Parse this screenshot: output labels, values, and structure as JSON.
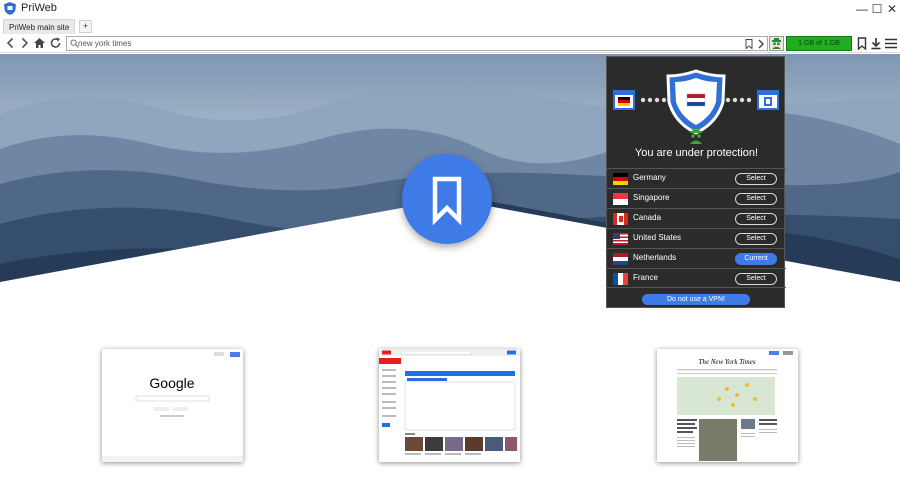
{
  "window": {
    "title": "PriWeb",
    "minimize_label": "—",
    "maximize_label": "☐",
    "close_label": "✕"
  },
  "tabs": [
    {
      "label": "PriWeb main site"
    }
  ],
  "new_tab_label": "+",
  "address_bar": {
    "value": "new york times"
  },
  "traffic": {
    "label": "1 GB of 1 GB",
    "used_fraction": 1.0,
    "color": "#1fae1f"
  },
  "icons": {
    "back": "chevron-left-icon",
    "forward": "chevron-right-icon",
    "home": "home-icon",
    "reload": "reload-icon",
    "search": "search-icon",
    "bookmark": "bookmark-icon",
    "download": "download-icon",
    "menu": "hamburger-icon",
    "vpn": "vpn-agent-icon"
  },
  "vpn_panel": {
    "status_text": "You are under protection!",
    "source_flag": "Germany",
    "active_flag": "Netherlands",
    "countries": [
      {
        "name": "Germany",
        "action": "Select",
        "current": false
      },
      {
        "name": "Singapore",
        "action": "Select",
        "current": false
      },
      {
        "name": "Canada",
        "action": "Select",
        "current": false
      },
      {
        "name": "United States",
        "action": "Select",
        "current": false
      },
      {
        "name": "Netherlands",
        "action": "Current",
        "current": true
      },
      {
        "name": "France",
        "action": "Select",
        "current": false
      }
    ],
    "no_vpn_label": "Do not use a VPN!"
  },
  "speed_dial": [
    {
      "site": "google",
      "logo": "Google"
    },
    {
      "site": "youtube",
      "logo": "YouTube"
    },
    {
      "site": "nytimes",
      "logo": "The New York Times"
    }
  ],
  "colors": {
    "accent": "#3e7be6",
    "panel_bg": "#2b2b2b"
  }
}
